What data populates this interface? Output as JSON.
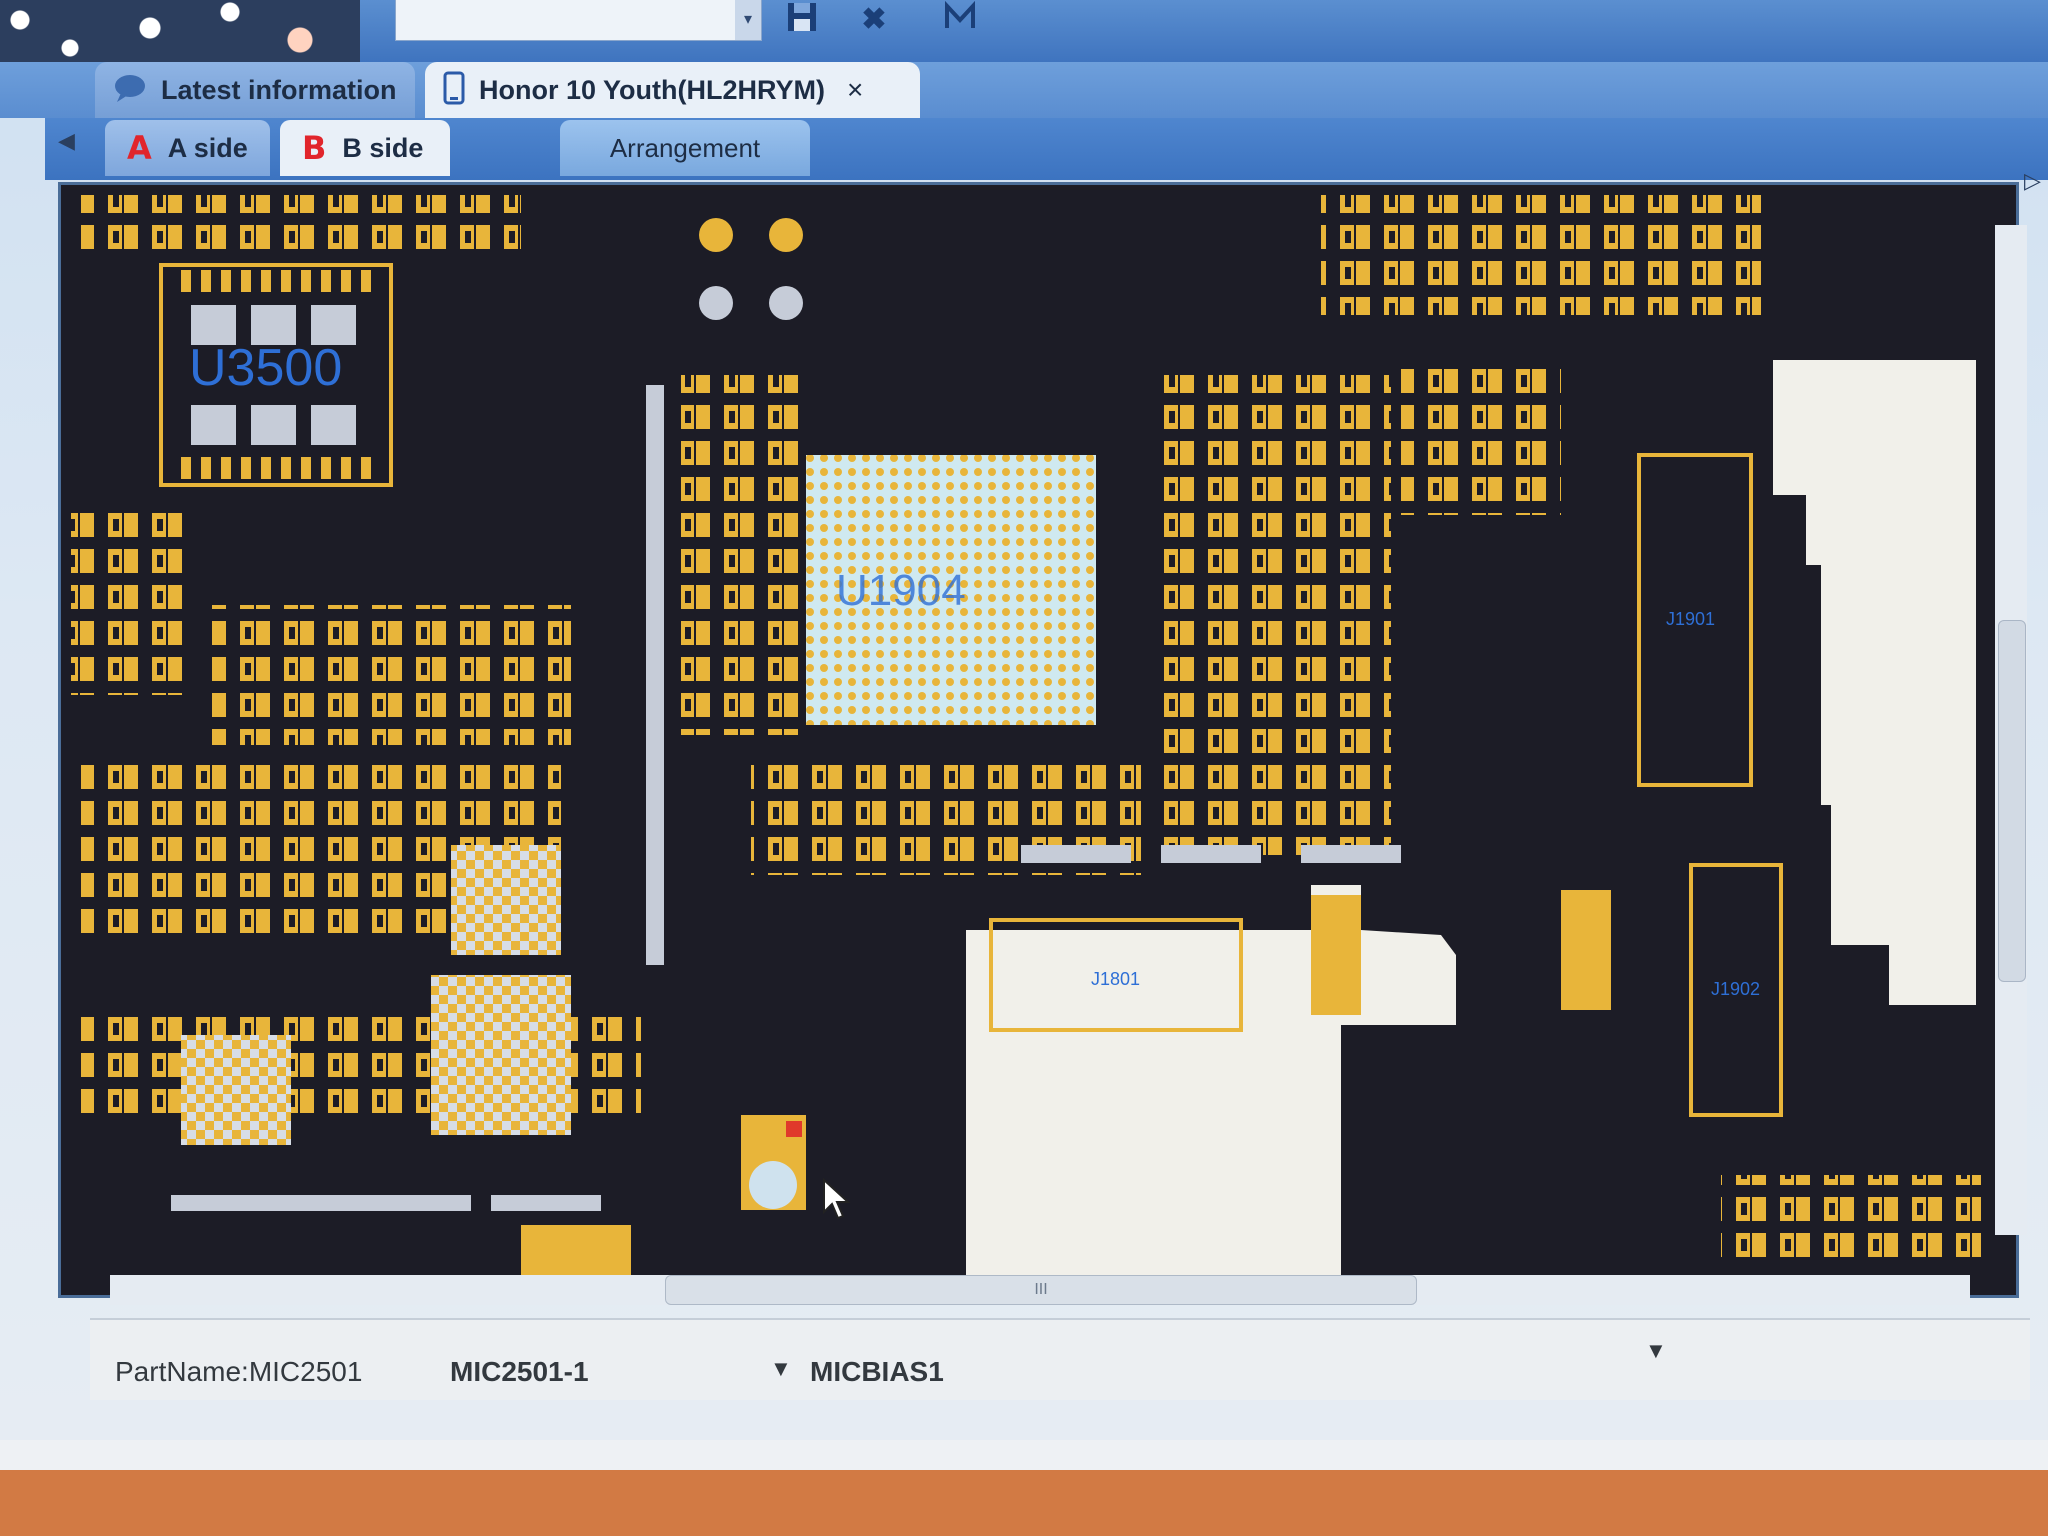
{
  "toolbar": {
    "combo_value": "",
    "icons": [
      "save-icon",
      "close-x-icon",
      "measure-icon"
    ]
  },
  "tabs": {
    "latest_info": "Latest information",
    "device": "Honor 10 Youth(HL2HRYM)",
    "close_glyph": "×"
  },
  "side_tabs": {
    "a_letter": "A",
    "a_label": "A side",
    "b_letter": "B",
    "b_label": "B side",
    "arrangement": "Arrangement"
  },
  "board": {
    "labels": [
      "U3500",
      "U1904",
      "J1901",
      "J1902",
      "J1801"
    ],
    "colors": {
      "background": "#1c1c26",
      "pad_gold": "#e8b53a",
      "pad_silver": "#c6ccd8",
      "shield_white": "#f1f0ea",
      "label_blue": "#2e6fd6"
    }
  },
  "status": {
    "part_name": "PartName:MIC2501",
    "pin": "MIC2501-1",
    "net": "MICBIAS1"
  },
  "scroll": {
    "h_grip": "III"
  }
}
